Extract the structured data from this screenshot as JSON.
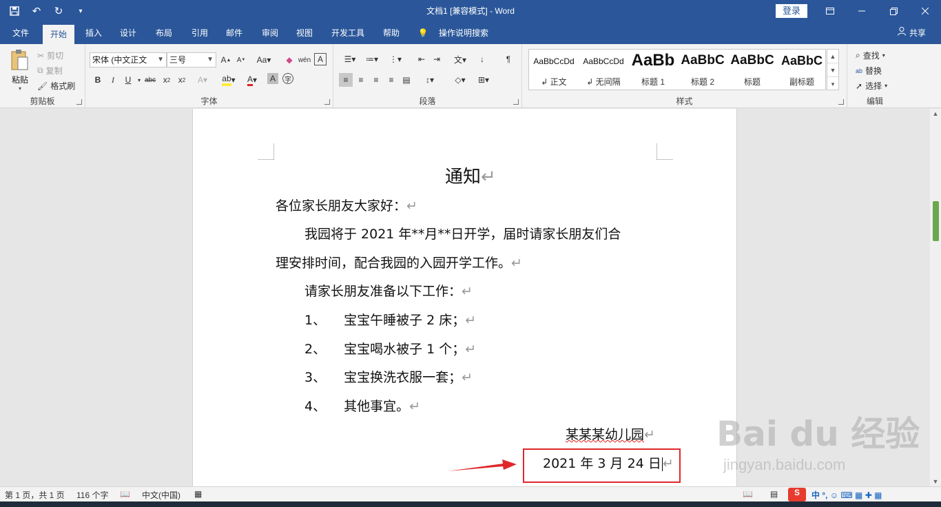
{
  "titlebar": {
    "title": "文档1 [兼容模式]  -  Word",
    "login": "登录"
  },
  "tabs": [
    "文件",
    "开始",
    "插入",
    "设计",
    "布局",
    "引用",
    "邮件",
    "审阅",
    "视图",
    "开发工具",
    "帮助",
    "操作说明搜索"
  ],
  "share": "共享",
  "clipboard": {
    "paste": "粘贴",
    "cut": "剪切",
    "copy": "复制",
    "format_painter": "格式刷",
    "label": "剪贴板"
  },
  "font": {
    "name": "宋体 (中文正文",
    "size": "三号",
    "label": "字体"
  },
  "paragraph": {
    "label": "段落"
  },
  "styles": {
    "label": "样式",
    "items": [
      {
        "preview": "AaBbCcDd",
        "name": "↲ 正文"
      },
      {
        "preview": "AaBbCcDd",
        "name": "↲ 无间隔"
      },
      {
        "preview": "AaBb",
        "name": "标题 1"
      },
      {
        "preview": "AaBbC",
        "name": "标题 2"
      },
      {
        "preview": "AaBbC",
        "name": "标题"
      },
      {
        "preview": "AaBbC",
        "name": "副标题"
      }
    ]
  },
  "editing": {
    "find": "查找",
    "replace": "替换",
    "select": "选择",
    "label": "编辑"
  },
  "document": {
    "title": "通知",
    "greeting": "各位家长朋友大家好：",
    "para1_line1": "我园将于 2021 年**月**日开学，届时请家长朋友们合",
    "para1_line2": "理安排时间，配合我园的入园开学工作。",
    "para2": "请家长朋友准备以下工作：",
    "list": [
      {
        "num": "1、",
        "text": "宝宝午睡被子 2 床；"
      },
      {
        "num": "2、",
        "text": "宝宝喝水被子 1 个；"
      },
      {
        "num": "3、",
        "text": "宝宝换洗衣服一套；"
      },
      {
        "num": "4、",
        "text": "其他事宜。"
      }
    ],
    "signature": "某某某幼儿园",
    "date": "2021 年 3 月 24 日",
    "para_mark": "↵"
  },
  "statusbar": {
    "page": "第 1 页，共 1 页",
    "words": "116 个字",
    "language": "中文(中国)"
  },
  "watermark": {
    "brand": "Bai du 经验",
    "url": "jingyan.baidu.com"
  },
  "colors": {
    "ribbon_blue": "#2b579a",
    "annotation_red": "#e0262b"
  }
}
